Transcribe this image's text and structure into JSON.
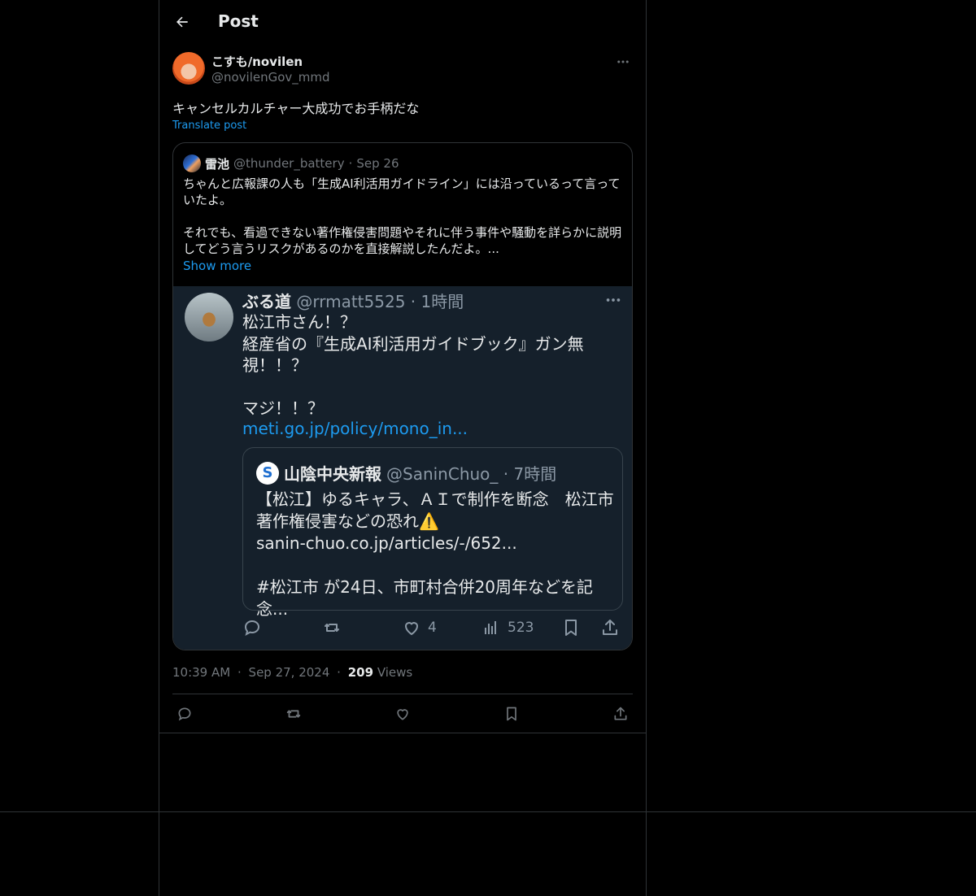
{
  "header": {
    "title": "Post"
  },
  "post": {
    "author_name": "こすも/novilen",
    "author_handle": "@novilenGov_mmd",
    "text": "キャンセルカルチャー大成功でお手柄だな",
    "translate_label": "Translate post",
    "time": "10:39 AM",
    "date": "Sep 27, 2024",
    "views_count": "209",
    "views_label": "Views",
    "separator": "·"
  },
  "quote": {
    "name": "雷池",
    "handle": "@thunder_battery",
    "dot": "·",
    "date": "Sep 26",
    "body": "ちゃんと広報課の人も「生成AI利活用ガイドライン」には沿っているって言っていたよ。\n\nそれでも、看過できない著作権侵害問題やそれに伴う事件や騒動を詳らかに説明してどう言うリスクがあるのかを直接解説したんだよ。...",
    "show_more": "Show more"
  },
  "screenshot": {
    "name": "ぶる道",
    "handle": "@rrmatt5525 · 1時間",
    "body": "松江市さん！？\n経産省の『生成AI利活用ガイドブック』ガン無\n視！！？\n\nマジ！！？",
    "link": "meti.go.jp/policy/mono_in...",
    "inner": {
      "logo": "S",
      "name": "山陰中央新報",
      "handle": "@SaninChuo_ · 7時間",
      "body": "【松江】ゆるキャラ、ＡＩで制作を断念　松江市\n著作権侵害などの恐れ⚠️\nsanin-chuo.co.jp/articles/-/652...\n\n#松江市 が24日、市町村合併20周年などを記念..."
    },
    "likes": "4",
    "views": "523"
  },
  "icons": {
    "back": "arrow-left-icon",
    "more": "more-horizontal-icon",
    "reply": "reply-icon",
    "repost": "repost-icon",
    "like": "heart-icon",
    "bookmark": "bookmark-icon",
    "share": "share-icon",
    "views": "analytics-icon"
  }
}
